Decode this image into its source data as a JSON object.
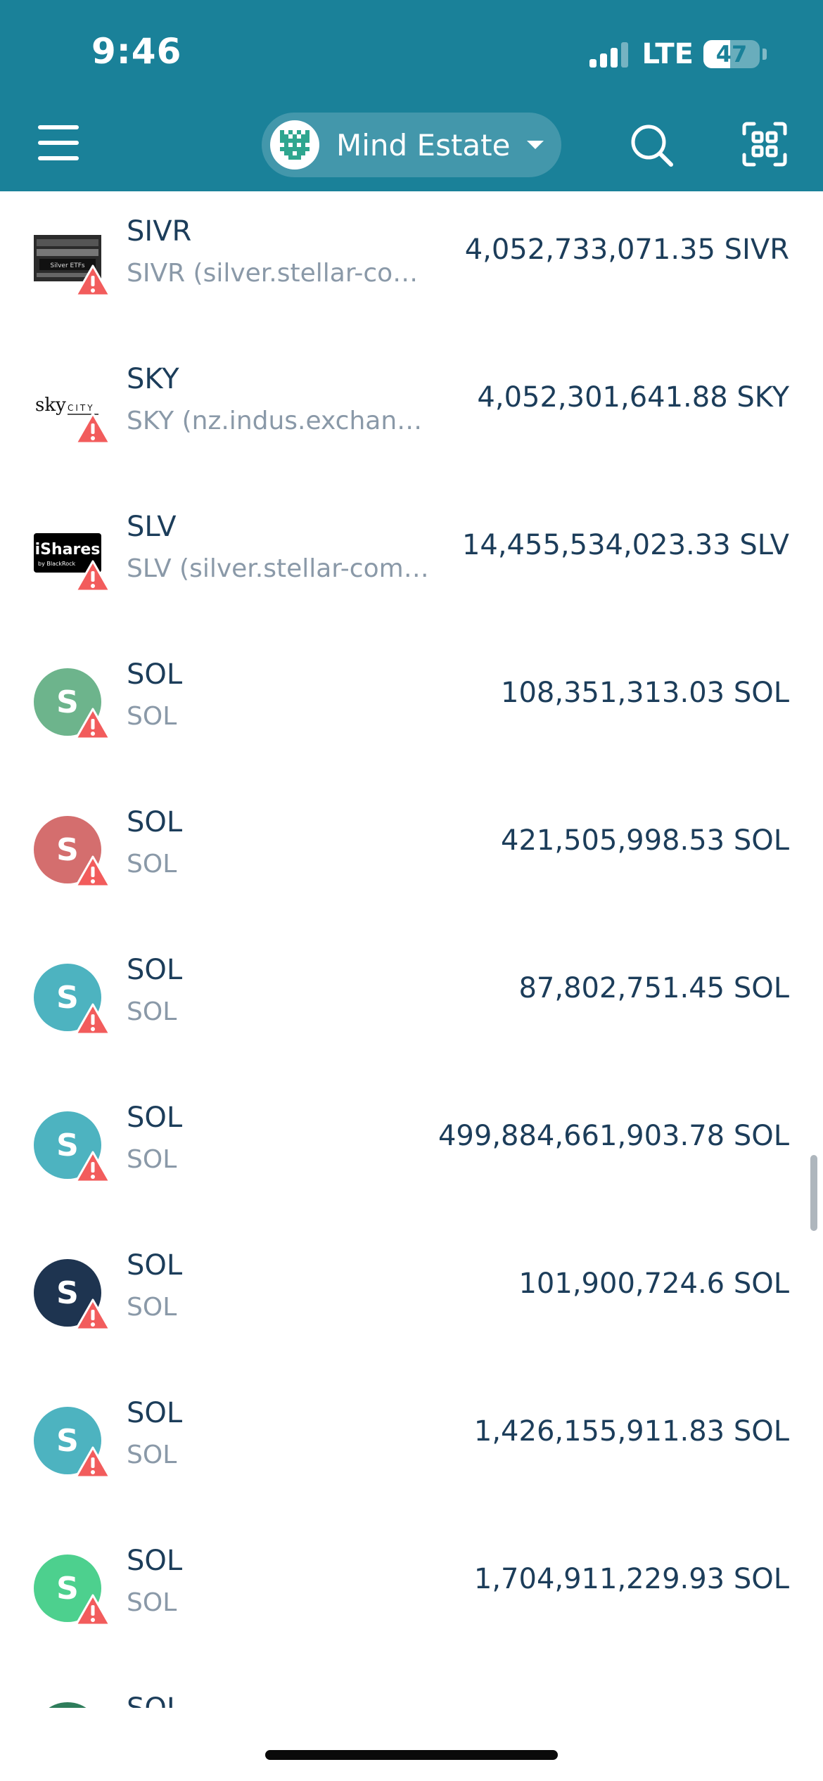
{
  "status_bar": {
    "time": "9:46",
    "network": "LTE",
    "battery": "47",
    "battery_level_percent": 47
  },
  "header": {
    "menu_icon": "hamburger-menu-icon",
    "account_name": "Mind Estate",
    "search_icon": "search-icon",
    "scan_icon": "qr-scan-icon",
    "brand_color": "#1a8199"
  },
  "assets": [
    {
      "code": "SIVR",
      "issuer": "SIVR (silver.stellar-community.org)",
      "amount": "4,052,733,071.35 SIVR",
      "icon": "silver-etf-logo",
      "warning": true
    },
    {
      "code": "SKY",
      "issuer": "SKY (nz.indus.exchange)",
      "amount": "4,052,301,641.88 SKY",
      "icon": "skycity-logo",
      "warning": true
    },
    {
      "code": "SLV",
      "issuer": "SLV (silver.stellar-community.org)",
      "amount": "14,455,534,023.33 SLV",
      "icon": "ishares-logo",
      "warning": true
    },
    {
      "code": "SOL",
      "issuer": "SOL",
      "amount": "108,351,313.03 SOL",
      "icon_letter": "S",
      "icon_color": "#6db48c",
      "warning": true
    },
    {
      "code": "SOL",
      "issuer": "SOL",
      "amount": "421,505,998.53 SOL",
      "icon_letter": "S",
      "icon_color": "#d46e6e",
      "warning": true
    },
    {
      "code": "SOL",
      "issuer": "SOL",
      "amount": "87,802,751.45 SOL",
      "icon_letter": "S",
      "icon_color": "#4db3c0",
      "warning": true
    },
    {
      "code": "SOL",
      "issuer": "SOL",
      "amount": "499,884,661,903.78 SOL",
      "icon_letter": "S",
      "icon_color": "#4db3c0",
      "warning": true
    },
    {
      "code": "SOL",
      "issuer": "SOL",
      "amount": "101,900,724.6 SOL",
      "icon_letter": "S",
      "icon_color": "#1e3450",
      "warning": true
    },
    {
      "code": "SOL",
      "issuer": "SOL",
      "amount": "1,426,155,911.83 SOL",
      "icon_letter": "S",
      "icon_color": "#4db3c0",
      "warning": true
    },
    {
      "code": "SOL",
      "issuer": "SOL",
      "amount": "1,704,911,229.93 SOL",
      "icon_letter": "S",
      "icon_color": "#4dd08e",
      "warning": true
    },
    {
      "code": "SOL",
      "issuer": "",
      "amount": "",
      "icon_letter": "",
      "icon_color": "#2e7d5b",
      "warning": false
    }
  ],
  "colors": {
    "warning": "#f25c5c",
    "title_text": "#1c3d5a",
    "subtitle_text": "#8a99a8"
  }
}
